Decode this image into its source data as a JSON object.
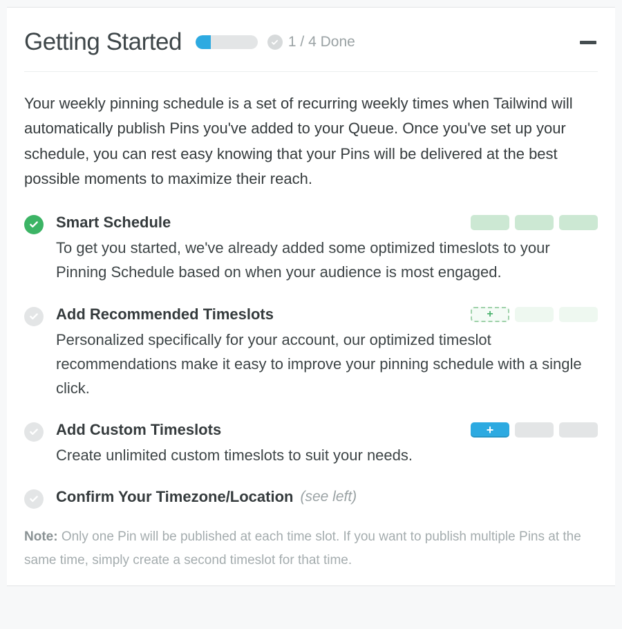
{
  "header": {
    "title": "Getting Started",
    "progress_fraction": 0.25,
    "progress_label": "1 / 4 Done"
  },
  "intro": "Your weekly pinning schedule is a set of recurring weekly times when Tailwind will automatically publish Pins you've added to your Queue. Once you've set up your schedule, you can rest easy knowing that your Pins will be delivered at the best possible moments to maximize their reach.",
  "steps": [
    {
      "title": "Smart Schedule",
      "desc": "To get you started, we've already added some optimized timeslots to your Pinning Schedule based on when your audience is most engaged.",
      "done": true
    },
    {
      "title": "Add Recommended Timeslots",
      "desc": "Personalized specifically for your account, our optimized timeslot recommendations make it easy to improve your pinning schedule with a single click.",
      "done": false,
      "add_label": "+"
    },
    {
      "title": "Add Custom Timeslots",
      "desc": "Create unlimited custom timeslots to suit your needs.",
      "done": false,
      "add_label": "+"
    },
    {
      "title": "Confirm Your Timezone/Location",
      "hint": "(see left)",
      "done": false
    }
  ],
  "note": {
    "label": "Note:",
    "text": " Only one Pin will be published at each time slot. If you want to publish multiple Pins at the same time, simply create a second timeslot for that time."
  }
}
